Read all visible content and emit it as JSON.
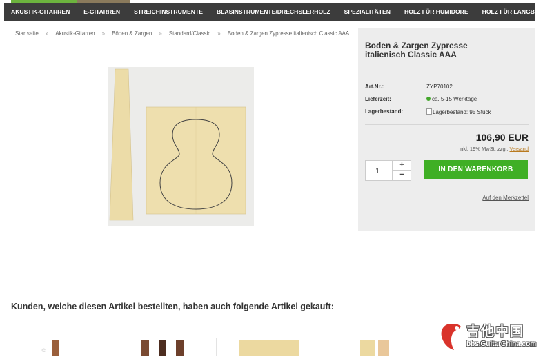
{
  "nav": {
    "items": [
      {
        "label": "AKUSTIK-GITARREN"
      },
      {
        "label": "E-GITARREN"
      },
      {
        "label": "STREICHINSTRUMENTE"
      },
      {
        "label": "BLASINSTRUMENTE/DRECHSLERHOLZ"
      },
      {
        "label": "SPEZIALITÄTEN"
      },
      {
        "label": "HOLZ FÜR HUMIDORE"
      },
      {
        "label": "HOLZ FÜR LANGBÖGEN"
      }
    ]
  },
  "breadcrumb": [
    "Startseite",
    "Akustik-Gitarren",
    "Böden & Zargen",
    "Standard/Classic",
    "Boden & Zargen Zypresse italienisch Classic AAA"
  ],
  "breadcrumb_sep": "»",
  "product": {
    "title": "Boden & Zargen Zypresse italienisch Classic AAA",
    "artnr_label": "Art.Nr.:",
    "artnr_value": "ZYP70102",
    "delivery_label": "Lieferzeit:",
    "delivery_value": "ca. 5-15 Werktage",
    "stock_label": "Lagerbestand:",
    "stock_value": "Lagerbestand: 95 Stück",
    "price": "106,90 EUR",
    "tax_text": "inkl. 19% MwSt. zzgl.",
    "shipping_link": "Versand",
    "quantity": "1",
    "plus": "+",
    "minus": "−",
    "cart_button": "IN DEN WARENKORB",
    "wishlist_link": "Auf den Merkzettel",
    "status_color": "#44a72c"
  },
  "also_bought": {
    "heading": "Kunden, welche diesen Artikel bestellten, haben auch folgende Artikel gekauft:"
  },
  "watermark": {
    "line1": "吉他中国",
    "line2": "bbs.GuitarChina.com"
  },
  "colors": {
    "nav_bg": "#3c3c3c",
    "cart_button": "#3faf25",
    "panel_bg": "#ededed",
    "link_accent": "#b97a1f"
  }
}
